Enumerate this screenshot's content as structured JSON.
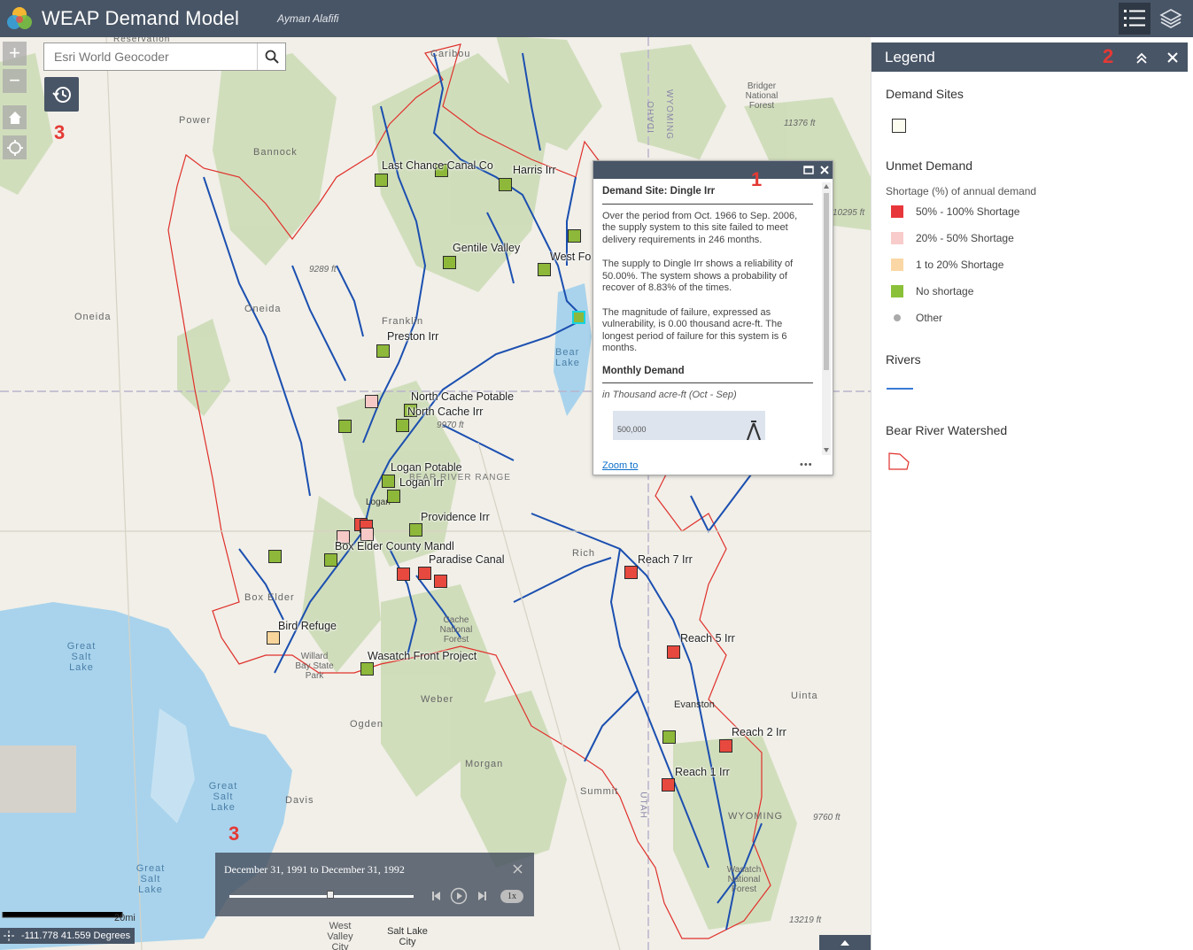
{
  "header": {
    "title": "WEAP Demand Model",
    "author": "Ayman Alafifi"
  },
  "search": {
    "placeholder": "Esri World Geocoder"
  },
  "annotations": {
    "n1": "1",
    "n2": "2",
    "n3a": "3",
    "n3b": "3"
  },
  "map_labels": {
    "bannock": "Bannock",
    "power": "Power",
    "oneida": "Oneida",
    "oneida_town": "Oneida",
    "franklin": "Franklin",
    "bear_lake": "Bear Lake",
    "box_elder": "Box Elder",
    "great_salt_lake": "Great Salt Lake",
    "great_salt_lake2": "Great Salt Lake",
    "great_salt_lake3": "Great Salt Lake",
    "ogden": "Ogden",
    "davis": "Davis",
    "morgan": "Morgan",
    "summit": "Summit",
    "evanston": "Evanston",
    "uinta": "Uinta",
    "wyoming": "WYOMING",
    "wyoming_v": "WYOMING",
    "idaho": "IDAHO",
    "utah": "UTAH",
    "salt_lake_city": "Salt Lake City",
    "west_valley": "West Valley City",
    "cache_forest": "Cache National Forest",
    "wasatch_forest": "Wasatch National Forest",
    "bridger_forest": "Bridger National Forest",
    "bear_river_range": "BEAR RIVER RANGE",
    "willard": "Willard Bay State Park",
    "caribou": "Caribou",
    "logan": "Logan",
    "weber": "Weber",
    "rich": "Rich",
    "reservation": "Reservation",
    "elev1": "11376 ft",
    "elev2": "9289 ft",
    "elev3": "9970 ft",
    "elev4": "9760 ft",
    "elev5": "13219 ft",
    "elev6": "10295 ft"
  },
  "sites": [
    {
      "name": "Last Chance Canal Co",
      "status": "none"
    },
    {
      "name": "Harris Irr",
      "status": "none"
    },
    {
      "name": "Gentile Valley",
      "status": "none"
    },
    {
      "name": "West Fo",
      "status": "none"
    },
    {
      "name": "Preston Irr",
      "status": "none"
    },
    {
      "name": "North Cache Potable",
      "status": "none"
    },
    {
      "name": "North Cache Irr",
      "status": "none"
    },
    {
      "name": "Logan Potable",
      "status": "none"
    },
    {
      "name": "Logan Irr",
      "status": "none"
    },
    {
      "name": "Providence Irr",
      "status": "none"
    },
    {
      "name": "Box Elder County Mandl",
      "status": "none"
    },
    {
      "name": "Paradise Canal",
      "status": "high"
    },
    {
      "name": "Bird Refuge",
      "status": "low"
    },
    {
      "name": "Wasatch Front Project",
      "status": "none"
    },
    {
      "name": "Reach 7 Irr",
      "status": "high"
    },
    {
      "name": "Reach 5 Irr",
      "status": "high"
    },
    {
      "name": "Reach 2 Irr",
      "status": "high"
    },
    {
      "name": "Reach 1 Irr",
      "status": "high"
    }
  ],
  "popup": {
    "title": "Demand Site: Dingle Irr",
    "p1": "Over the period from Oct. 1966 to Sep. 2006, the supply system to this site failed to meet delivery requirements in 246 months.",
    "p2": "The supply to Dingle Irr shows a reliability of 50.00%. The system shows a probability of recover of 8.83% of the times.",
    "p3": "The magnitude of failure, expressed as vulnerability, is 0.00 thousand acre-ft. The longest period of failure for this system is 6 months.",
    "section": "Monthly Demand",
    "unit": "in Thousand acre-ft (Oct - Sep)",
    "chart_tick": "500,000",
    "zoom_to": "Zoom to",
    "more": "•••"
  },
  "time_slider": {
    "range": "December 31, 1991 to December 31, 1992",
    "speed": "1x",
    "position": 0.55
  },
  "scale_bar": {
    "label": "20mi"
  },
  "coordinates": {
    "text": "-111.778 41.559 Degrees"
  },
  "legend": {
    "title": "Legend",
    "demand_sites": "Demand Sites",
    "unmet_demand": "Unmet Demand",
    "unmet_sub": "Shortage (%) of annual demand",
    "items": [
      {
        "label": "50% - 100% Shortage",
        "color": "#e8373a"
      },
      {
        "label": "20% - 50% Shortage",
        "color": "#f8ccca"
      },
      {
        "label": "1 to 20% Shortage",
        "color": "#fad7a4"
      },
      {
        "label": "No shortage",
        "color": "#8bc13a"
      },
      {
        "label": "Other",
        "color": "#aaaaaa"
      }
    ],
    "rivers": "Rivers",
    "watershed": "Bear River Watershed"
  },
  "colors": {
    "header": "#485566",
    "river": "#1b4fb0",
    "boundary": "#e0302b",
    "forest": "#c9d9b0"
  }
}
